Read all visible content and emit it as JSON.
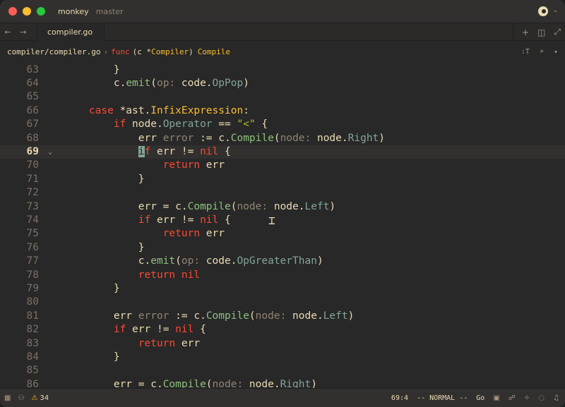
{
  "titlebar": {
    "project": "monkey",
    "branch": "master"
  },
  "tabbar": {
    "back": "←",
    "forward": "→",
    "active_tab": "compiler.go",
    "plus": "+",
    "split": "◫",
    "more": "⤢"
  },
  "breadcrumb": {
    "path": "compiler/compiler.go",
    "sep": "›",
    "keyword": "func",
    "receiver_open": "(c *",
    "receiver_type": "Compiler",
    "receiver_close": ")",
    "function": "Compile",
    "symbol_btn": ":T",
    "search_btn": "⌕",
    "assist_btn": "✦"
  },
  "editor": {
    "lines": [
      {
        "n": "63",
        "code": [
          [
            "",
            "        }"
          ]
        ]
      },
      {
        "n": "64",
        "code": [
          [
            "",
            "        c."
          ],
          [
            "fn",
            "emit"
          ],
          [
            "",
            "("
          ],
          [
            "hint",
            "op: "
          ],
          [
            "",
            "code."
          ],
          [
            "fld",
            "OpPop"
          ],
          [
            "",
            ")"
          ]
        ]
      },
      {
        "n": "65",
        "code": []
      },
      {
        "n": "66",
        "code": [
          [
            "",
            "    "
          ],
          [
            "kw",
            "case"
          ],
          [
            "",
            " *ast."
          ],
          [
            "ty",
            "InfixExpression"
          ],
          [
            "",
            ":"
          ]
        ]
      },
      {
        "n": "67",
        "code": [
          [
            "",
            "        "
          ],
          [
            "kw",
            "if"
          ],
          [
            "",
            " node."
          ],
          [
            "fld",
            "Operator"
          ],
          [
            "",
            " == "
          ],
          [
            "str",
            "\"<\""
          ],
          [
            "",
            " {"
          ]
        ]
      },
      {
        "n": "68",
        "code": [
          [
            "",
            "            err "
          ],
          [
            "hint",
            "error"
          ],
          [
            "",
            " := c."
          ],
          [
            "fn",
            "Compile"
          ],
          [
            "",
            "("
          ],
          [
            "hint",
            "node: "
          ],
          [
            "",
            "node."
          ],
          [
            "fld",
            "Right"
          ],
          [
            "",
            ")"
          ]
        ]
      },
      {
        "n": "69",
        "active": true,
        "fold": "⌄",
        "code": [
          [
            "",
            "            "
          ],
          [
            "cur",
            "i"
          ],
          [
            "kw",
            "f"
          ],
          [
            "",
            " err != "
          ],
          [
            "kw",
            "nil"
          ],
          [
            "",
            " {"
          ]
        ]
      },
      {
        "n": "70",
        "code": [
          [
            "",
            "                "
          ],
          [
            "kw",
            "return"
          ],
          [
            "",
            " err"
          ]
        ]
      },
      {
        "n": "71",
        "code": [
          [
            "",
            "            }"
          ]
        ]
      },
      {
        "n": "72",
        "code": []
      },
      {
        "n": "73",
        "code": [
          [
            "",
            "            err = c."
          ],
          [
            "fn",
            "Compile"
          ],
          [
            "",
            "("
          ],
          [
            "hint",
            "node: "
          ],
          [
            "",
            "node."
          ],
          [
            "fld",
            "Left"
          ],
          [
            "",
            ")"
          ]
        ]
      },
      {
        "n": "74",
        "code": [
          [
            "",
            "            "
          ],
          [
            "kw",
            "if"
          ],
          [
            "",
            " err != "
          ],
          [
            "kw",
            "nil"
          ],
          [
            "",
            " {"
          ]
        ]
      },
      {
        "n": "75",
        "code": [
          [
            "",
            "                "
          ],
          [
            "kw",
            "return"
          ],
          [
            "",
            " err"
          ]
        ]
      },
      {
        "n": "76",
        "code": [
          [
            "",
            "            }"
          ]
        ]
      },
      {
        "n": "77",
        "code": [
          [
            "",
            "            c."
          ],
          [
            "fn",
            "emit"
          ],
          [
            "",
            "("
          ],
          [
            "hint",
            "op: "
          ],
          [
            "",
            "code."
          ],
          [
            "fld",
            "OpGreaterThan"
          ],
          [
            "",
            ")"
          ]
        ]
      },
      {
        "n": "78",
        "code": [
          [
            "",
            "            "
          ],
          [
            "kw",
            "return"
          ],
          [
            "",
            " "
          ],
          [
            "kw",
            "nil"
          ]
        ]
      },
      {
        "n": "79",
        "code": [
          [
            "",
            "        }"
          ]
        ]
      },
      {
        "n": "80",
        "code": []
      },
      {
        "n": "81",
        "code": [
          [
            "",
            "        err "
          ],
          [
            "hint",
            "error"
          ],
          [
            "",
            " := c."
          ],
          [
            "fn",
            "Compile"
          ],
          [
            "",
            "("
          ],
          [
            "hint",
            "node: "
          ],
          [
            "",
            "node."
          ],
          [
            "fld",
            "Left"
          ],
          [
            "",
            ")"
          ]
        ]
      },
      {
        "n": "82",
        "code": [
          [
            "",
            "        "
          ],
          [
            "kw",
            "if"
          ],
          [
            "",
            " err != "
          ],
          [
            "kw",
            "nil"
          ],
          [
            "",
            " {"
          ]
        ]
      },
      {
        "n": "83",
        "code": [
          [
            "",
            "            "
          ],
          [
            "kw",
            "return"
          ],
          [
            "",
            " err"
          ]
        ]
      },
      {
        "n": "84",
        "code": [
          [
            "",
            "        }"
          ]
        ]
      },
      {
        "n": "85",
        "code": []
      },
      {
        "n": "86",
        "code": [
          [
            "",
            "        err = c."
          ],
          [
            "fn",
            "Compile"
          ],
          [
            "",
            "("
          ],
          [
            "hint",
            "node: "
          ],
          [
            "",
            "node."
          ],
          [
            "fld",
            "Right"
          ],
          [
            "",
            ")"
          ]
        ]
      }
    ]
  },
  "statusbar": {
    "warnings": "34",
    "position": "69:4",
    "mode": "-- NORMAL --",
    "language": "Go"
  }
}
